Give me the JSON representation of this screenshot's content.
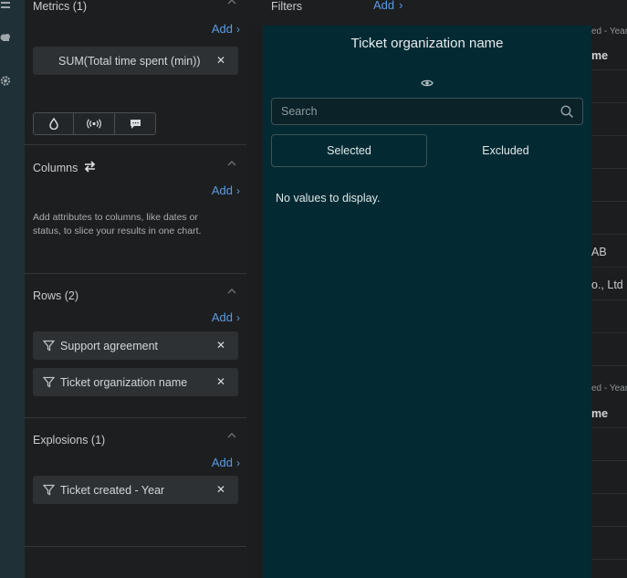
{
  "config": {
    "metrics": {
      "title": "Metrics (1)",
      "add_label": "Add",
      "items": [
        {
          "label": "SUM(Total time spent (min))"
        }
      ],
      "viz_icons": [
        "drop-icon",
        "broadcast-icon",
        "comment-icon"
      ]
    },
    "columns": {
      "title": "Columns",
      "add_label": "Add",
      "help": "Add attributes to columns, like dates or status, to slice your results in one chart."
    },
    "rows": {
      "title": "Rows (2)",
      "add_label": "Add",
      "items": [
        {
          "label": "Support agreement"
        },
        {
          "label": "Ticket organization name"
        }
      ]
    },
    "explosions": {
      "title": "Explosions (1)",
      "add_label": "Add",
      "items": [
        {
          "label": "Ticket created - Year"
        }
      ]
    }
  },
  "filters": {
    "label": "Filters",
    "add_label": "Add"
  },
  "dialog": {
    "title": "Ticket organization name",
    "search_placeholder": "Search",
    "tabs": {
      "selected": "Selected",
      "excluded": "Excluded"
    },
    "empty_text": "No values to display."
  },
  "background_table": {
    "header_cells": [
      "ed - Year",
      "me"
    ],
    "cells": [
      "AB",
      "o., Ltd"
    ],
    "header_cells_2": [
      "ed - Year",
      "me"
    ]
  },
  "colors": {
    "accent": "#5b9be6",
    "dialog_bg": "#032a33",
    "rail_bg": "#1f3137"
  }
}
